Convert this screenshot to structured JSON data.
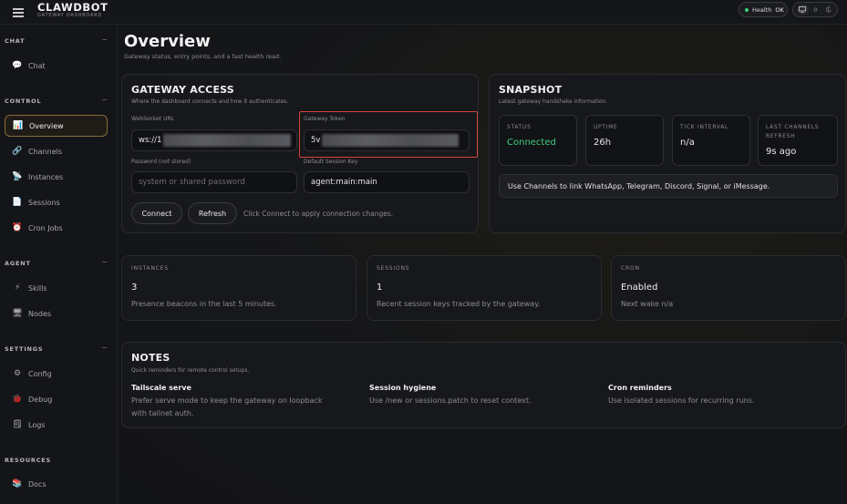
{
  "app": {
    "title": "CLAWDBOT",
    "subtitle": "GATEWAY DASHBOARD"
  },
  "header": {
    "health_label": "Health",
    "health_status": "OK",
    "health_color": "#3ad27a"
  },
  "sidebar": {
    "sections": [
      {
        "title": "CHAT",
        "items": [
          {
            "label": "Chat",
            "icon": "speech-bubble-icon"
          }
        ]
      },
      {
        "title": "CONTROL",
        "items": [
          {
            "label": "Overview",
            "icon": "bar-chart-icon",
            "active": true
          },
          {
            "label": "Channels",
            "icon": "link-icon"
          },
          {
            "label": "Instances",
            "icon": "satellite-icon"
          },
          {
            "label": "Sessions",
            "icon": "document-icon"
          },
          {
            "label": "Cron Jobs",
            "icon": "alarm-clock-icon"
          }
        ]
      },
      {
        "title": "AGENT",
        "items": [
          {
            "label": "Skills",
            "icon": "lightning-icon"
          },
          {
            "label": "Nodes",
            "icon": "monitor-icon"
          }
        ]
      },
      {
        "title": "SETTINGS",
        "items": [
          {
            "label": "Config",
            "icon": "gear-icon"
          },
          {
            "label": "Debug",
            "icon": "bug-icon"
          },
          {
            "label": "Logs",
            "icon": "notepad-icon"
          }
        ]
      },
      {
        "title": "RESOURCES",
        "items": [
          {
            "label": "Docs",
            "icon": "books-icon"
          }
        ]
      }
    ],
    "collapse_symbol": "−"
  },
  "page": {
    "title": "Overview",
    "subtitle": "Gateway status, entry points, and a fast health read."
  },
  "gateway_access": {
    "title": "GATEWAY ACCESS",
    "subtitle": "Where the dashboard connects and how it authenticates.",
    "websocket_label": "WebSocket URL",
    "websocket_value": "ws://1",
    "token_label": "Gateway Token",
    "token_value": "5v",
    "password_label": "Password (not stored)",
    "password_placeholder": "system or shared password",
    "session_key_label": "Default Session Key",
    "session_key_value": "agent:main:main",
    "connect_label": "Connect",
    "refresh_label": "Refresh",
    "hint": "Click Connect to apply connection changes."
  },
  "snapshot": {
    "title": "SNAPSHOT",
    "subtitle": "Latest gateway handshake information.",
    "status_label": "STATUS",
    "status_value": "Connected",
    "uptime_label": "UPTIME",
    "uptime_value": "26h",
    "tick_label": "TICK INTERVAL",
    "tick_value": "n/a",
    "refresh_label_1": "LAST CHANNELS",
    "refresh_label_2": "REFRESH",
    "refresh_value": "9s ago",
    "info": "Use Channels to link WhatsApp, Telegram, Discord, Signal, or iMessage.",
    "status_color": "#3fd07e"
  },
  "stats": {
    "instances": {
      "label": "INSTANCES",
      "value": "3",
      "note": "Presence beacons in the last 5 minutes."
    },
    "sessions": {
      "label": "SESSIONS",
      "value": "1",
      "note": "Recent session keys tracked by the gateway."
    },
    "cron": {
      "label": "CRON",
      "value": "Enabled",
      "note": "Next wake n/a"
    }
  },
  "notes": {
    "title": "NOTES",
    "subtitle": "Quick reminders for remote control setups.",
    "items": [
      {
        "title": "Tailscale serve",
        "body_1": "Prefer serve mode to keep the gateway on loopback",
        "body_2": "with tailnet auth."
      },
      {
        "title": "Session hygiene",
        "body_1": "Use /new or sessions.patch to reset context."
      },
      {
        "title": "Cron reminders",
        "body_1": "Use isolated sessions for recurring runs."
      }
    ]
  },
  "accent_color": "#8a6b3a",
  "highlight_color": "#d8413a"
}
